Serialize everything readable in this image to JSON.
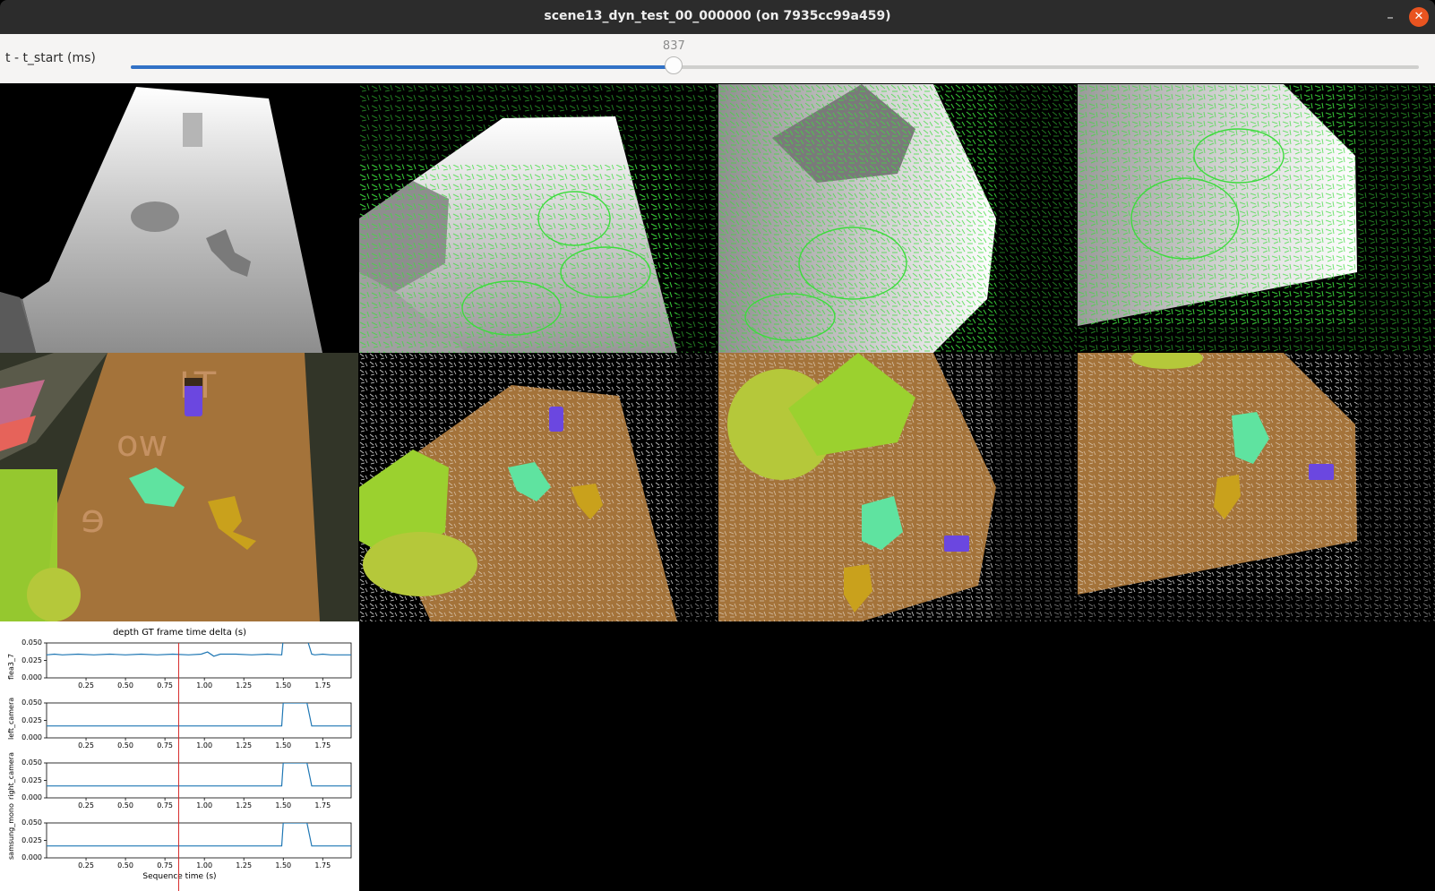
{
  "window": {
    "title": "scene13_dyn_test_00_000000 (on 7935cc99a459)",
    "minimize_glyph": "–",
    "close_glyph": "✕",
    "close_color": "#e95420"
  },
  "slider": {
    "label": "t - t_start (ms)",
    "value": 837,
    "value_text": "837",
    "max": 1985,
    "fill_color": "#3272c6"
  },
  "grid": {
    "rows": [
      {
        "name": "depth-ground-truth-row",
        "tiles": [
          "depth-map",
          "depth-with-green-events",
          "depth-with-green-events",
          "depth-with-green-events"
        ]
      },
      {
        "name": "segmentation-overlay-row",
        "tiles": [
          "rgb-with-segmentation",
          "segmentation-with-white-events",
          "segmentation-with-white-events",
          "segmentation-with-white-events"
        ]
      }
    ],
    "colors": {
      "event_green": "#3ddc3d",
      "mat_orange": "#a4733a",
      "object_lime": "#9bd12f",
      "object_mint": "#5fe3a0",
      "object_purple": "#6b47e0",
      "object_yellow": "#c9a11c"
    }
  },
  "plot": {
    "title": "depth GT frame time delta (s)",
    "xlabel": "Sequence time (s)",
    "cursor_time": 0.837,
    "cursor_color": "#d62728",
    "line_color": "#1f77b4",
    "xticks": [
      "0.25",
      "0.50",
      "0.75",
      "1.00",
      "1.25",
      "1.50",
      "1.75"
    ],
    "yticks": [
      "0.050",
      "0.025",
      "0.000"
    ],
    "subplots": [
      {
        "ylabel": "flea3_7"
      },
      {
        "ylabel": "left_camera"
      },
      {
        "ylabel": "right_camera"
      },
      {
        "ylabel": "samsung_mono"
      }
    ]
  },
  "chart_data": {
    "type": "line",
    "title": "depth GT frame time delta (s)",
    "xlabel": "Sequence time (s)",
    "xlim": [
      0.0,
      1.93
    ],
    "ylim": [
      0.0,
      0.05
    ],
    "series": [
      {
        "name": "flea3_7",
        "x": [
          0.0,
          0.05,
          0.1,
          0.2,
          0.3,
          0.4,
          0.5,
          0.6,
          0.7,
          0.8,
          0.9,
          0.98,
          1.02,
          1.06,
          1.1,
          1.2,
          1.3,
          1.4,
          1.49,
          1.5,
          1.65,
          1.68,
          1.7,
          1.75,
          1.8,
          1.85,
          1.9,
          1.93
        ],
        "y": [
          0.033,
          0.034,
          0.033,
          0.034,
          0.033,
          0.034,
          0.033,
          0.034,
          0.033,
          0.034,
          0.033,
          0.034,
          0.037,
          0.031,
          0.034,
          0.034,
          0.033,
          0.034,
          0.033,
          0.06,
          0.06,
          0.034,
          0.033,
          0.034,
          0.033,
          0.033,
          0.033,
          0.033
        ]
      },
      {
        "name": "left_camera",
        "x": [
          0.0,
          1.49,
          1.5,
          1.65,
          1.68,
          1.93
        ],
        "y": [
          0.017,
          0.017,
          0.05,
          0.05,
          0.017,
          0.017
        ]
      },
      {
        "name": "right_camera",
        "x": [
          0.0,
          1.49,
          1.5,
          1.65,
          1.68,
          1.93
        ],
        "y": [
          0.017,
          0.017,
          0.05,
          0.05,
          0.017,
          0.017
        ]
      },
      {
        "name": "samsung_mono",
        "x": [
          0.0,
          1.49,
          1.5,
          1.65,
          1.68,
          1.93
        ],
        "y": [
          0.017,
          0.017,
          0.05,
          0.05,
          0.017,
          0.017
        ]
      }
    ],
    "cursor_x": 0.837,
    "grid": false
  }
}
